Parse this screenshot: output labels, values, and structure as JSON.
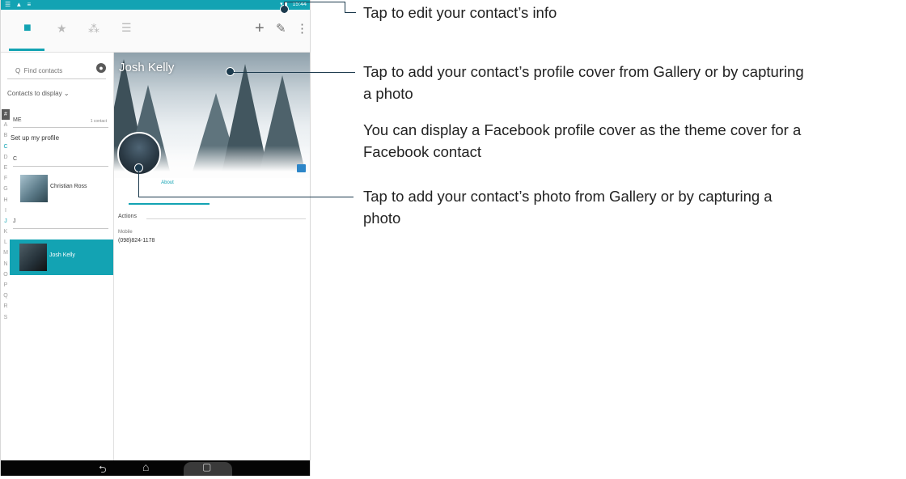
{
  "status_bar": {
    "left_icons": "☰ ▲ ≡",
    "time": "15:44"
  },
  "action_bar": {
    "tabs": [
      {
        "name": "contacts",
        "icon": "person-icon"
      },
      {
        "name": "favorites",
        "icon": "star-icon"
      },
      {
        "name": "groups",
        "icon": "group-icon"
      },
      {
        "name": "sort",
        "icon": "list-icon"
      }
    ],
    "actions": {
      "add": "+",
      "edit": "✎",
      "overflow": "⋮"
    }
  },
  "contacts_list": {
    "search_placeholder": "Q  Find contacts",
    "contacts_to_display": "Contacts to display ⌄",
    "index_letters": [
      "#",
      "A",
      "B",
      "C",
      "D",
      "E",
      "F",
      "G",
      "H",
      "I",
      "J",
      "K",
      "L",
      "M",
      "N",
      "O",
      "P",
      "Q",
      "R",
      "S"
    ],
    "me_header": "ME",
    "me_header_right": "1 contact",
    "setup_profile": "Set up my profile",
    "section_c": "C",
    "section_j": "J",
    "contacts": [
      {
        "name": "Christian Ross"
      },
      {
        "name": "Josh Kelly"
      }
    ]
  },
  "contact_detail": {
    "title": "Josh Kelly",
    "tab_label": "About",
    "actions_label": "Actions",
    "mobile_label": "Mobile",
    "phone": "(098)824-1178"
  },
  "nav_bar": {
    "back": "⮌",
    "home": "⌂",
    "recent": "▢"
  },
  "annotations": {
    "edit_info": "Tap to edit your contact’s info",
    "profile_cover_1": "Tap to add your contact’s profile cover from Gallery or by capturing",
    "profile_cover_2": "a photo",
    "facebook_1": "You can display a Facebook profile cover as the theme cover for a",
    "facebook_2": "Facebook contact",
    "contact_photo_1": "Tap to add your contact’s photo from Gallery or by capturing a",
    "contact_photo_2": "photo"
  },
  "colors": {
    "accent": "#13a3b3",
    "callout": "#1c3a4d",
    "nav": "#050505"
  }
}
